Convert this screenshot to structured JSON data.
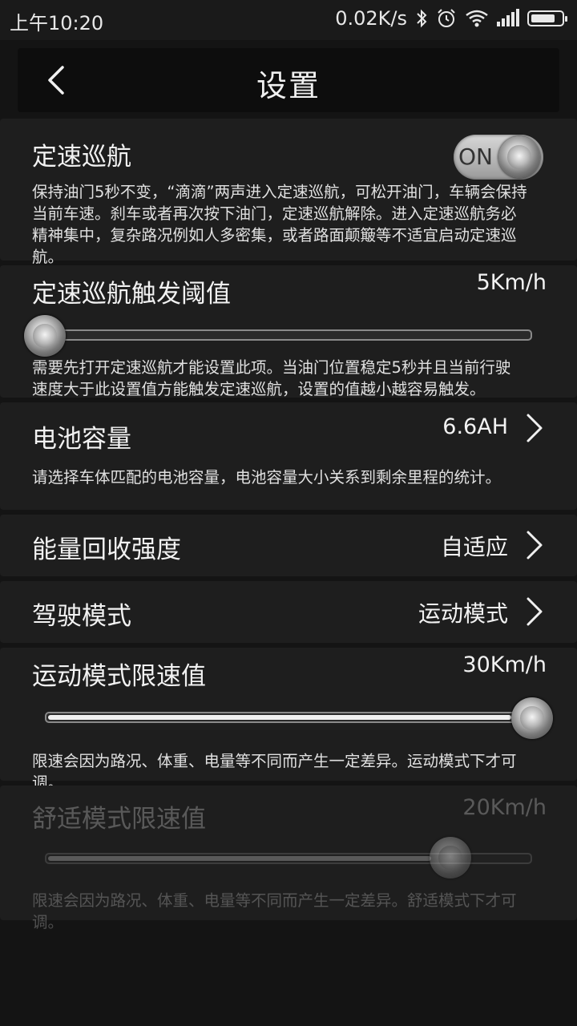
{
  "status_bar": {
    "time": "上午10:20",
    "speed": "0.02K/s",
    "icons": [
      "bluetooth-icon",
      "alarm-icon",
      "wifi-icon",
      "signal-icon",
      "battery-icon"
    ]
  },
  "header": {
    "title": "设置"
  },
  "cruise": {
    "label": "定速巡航",
    "toggle_text": "ON",
    "enabled": true,
    "desc": "保持油门5秒不变，“滴滴”两声进入定速巡航，可松开油门，车辆会保持当前车速。刹车或者再次按下油门，定速巡航解除。进入定速巡航务必精神集中，复杂路况例如人多密集，或者路面颠簸等不适宜启动定速巡航。"
  },
  "threshold": {
    "label": "定速巡航触发阈值",
    "value": "5Km/h",
    "slider_fraction": 0.0,
    "desc": "需要先打开定速巡航才能设置此项。当油门位置稳定5秒并且当前行驶速度大于此设置值方能触发定速巡航，设置的值越小越容易触发。"
  },
  "battery": {
    "label": "电池容量",
    "value": "6.6AH",
    "desc": "请选择车体匹配的电池容量，电池容量大小关系到剩余里程的统计。"
  },
  "regen": {
    "label": "能量回收强度",
    "value": "自适应"
  },
  "drive_mode": {
    "label": "驾驶模式",
    "value": "运动模式"
  },
  "sport_limit": {
    "label": "运动模式限速值",
    "value": "30Km/h",
    "slider_fraction": 1.0,
    "desc": "限速会因为路况、体重、电量等不同而产生一定差异。运动模式下才可调。"
  },
  "comfort_limit": {
    "label": "舒适模式限速值",
    "value": "20Km/h",
    "slider_fraction": 0.83,
    "disabled": true,
    "desc": "限速会因为路况、体重、电量等不同而产生一定差异。舒适模式下才可调。"
  }
}
